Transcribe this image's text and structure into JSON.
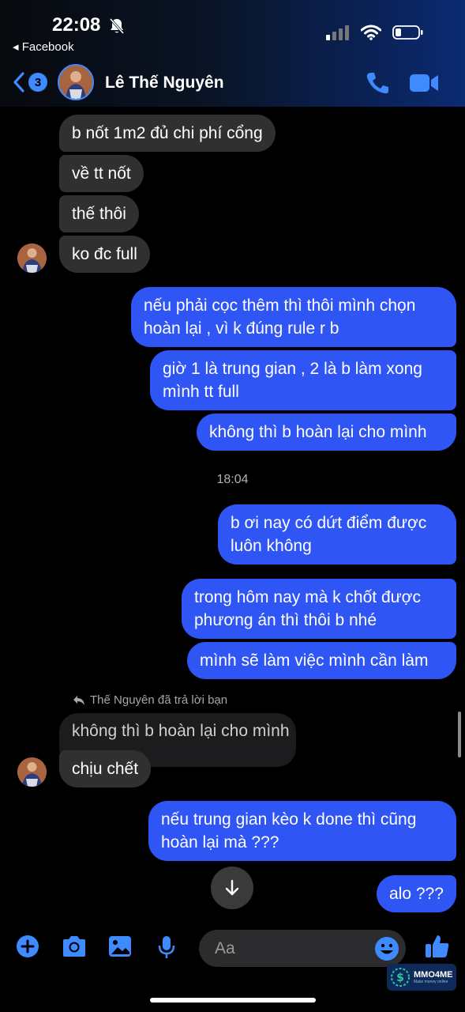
{
  "status_bar": {
    "time": "22:08",
    "back_app": "◂ Facebook"
  },
  "header": {
    "unread_count": "3",
    "contact_name": "Lê Thế Nguyên"
  },
  "colors": {
    "outgoing_bubble": "#2f55f5",
    "incoming_bubble": "#303030",
    "accent": "#3d8bff"
  },
  "messages_in_top": [
    "b nốt 1m2 đủ chi phí cổng",
    "về tt nốt",
    "thế thôi",
    "ko đc full"
  ],
  "messages_out_1": [
    [
      "nếu phải cọc thêm thì thôi mình chọn",
      "hoàn lại , vì k đúng rule r b"
    ],
    [
      "giờ 1 là trung gian , 2 là b làm xong",
      "mình tt full"
    ],
    [
      "không thì b hoàn lại cho mình"
    ]
  ],
  "timestamp": "18:04",
  "messages_out_2": [
    [
      "b ơi nay có dứt điểm được",
      "luôn không"
    ],
    [
      "trong hôm nay mà k chốt được",
      "phương án thì thôi b nhé"
    ],
    [
      "mình sẽ làm việc mình cần làm"
    ]
  ],
  "reply": {
    "label": "Thế Nguyên đã trả lời bạn",
    "quoted": "không thì b hoàn lại cho mình",
    "message": "chịu chết"
  },
  "messages_out_3": [
    [
      "nếu trung gian kèo k done thì cũng",
      "hoàn lại mà ???"
    ],
    [
      "alo ???"
    ]
  ],
  "composer": {
    "placeholder": "Aa"
  },
  "watermark": {
    "brand": "MMO4ME",
    "tagline": "Make money online"
  },
  "icons": [
    "bell-muted-icon",
    "signal-icon",
    "wifi-icon",
    "battery-icon",
    "back-chevron-icon",
    "phone-icon",
    "video-icon",
    "reply-arrow-icon",
    "arrow-down-icon",
    "plus-icon",
    "camera-icon",
    "image-icon",
    "microphone-icon",
    "emoji-icon",
    "thumbs-up-icon"
  ]
}
